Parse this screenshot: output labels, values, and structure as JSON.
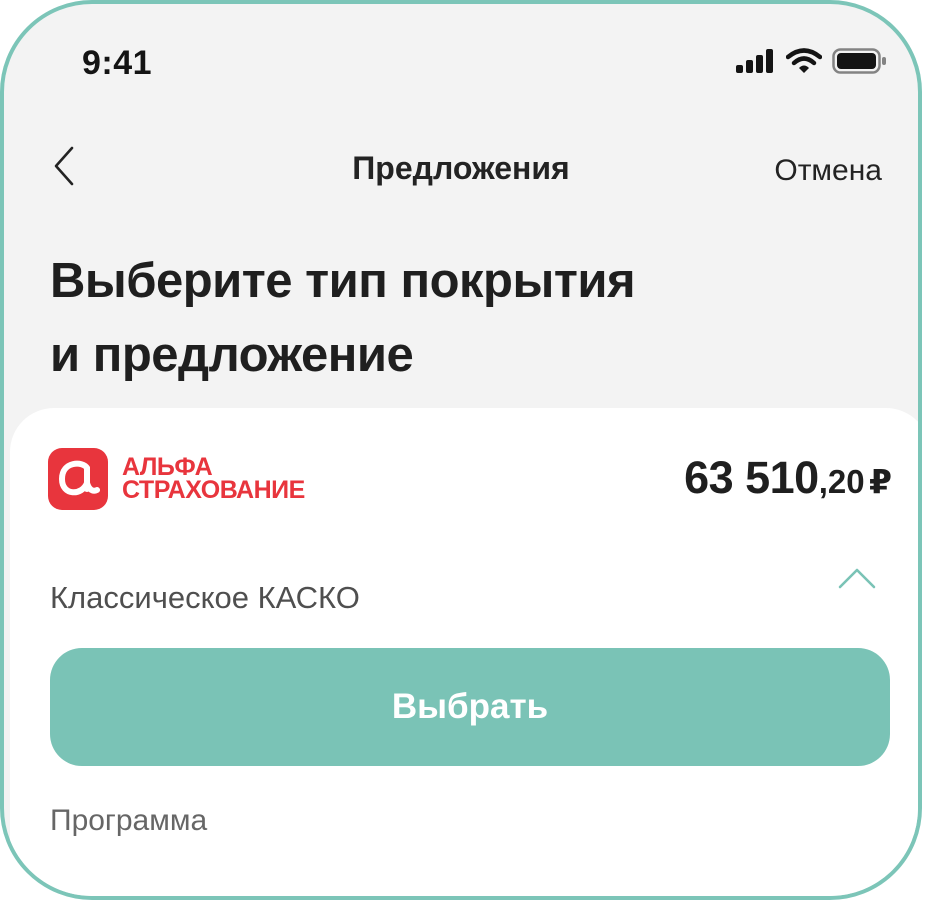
{
  "status_bar": {
    "time": "9:41",
    "icons": [
      "signal-icon",
      "wifi-icon",
      "battery-icon"
    ]
  },
  "nav": {
    "back_icon": "chevron-left-icon",
    "title": "Предложения",
    "cancel_label": "Отмена"
  },
  "heading": {
    "line1": "Выберите тип покрытия",
    "line2": "и предложение"
  },
  "offer": {
    "brand": {
      "logo_icon": "alfa-logo-icon",
      "name_line1": "АЛЬФА",
      "name_line2": "СТРАХОВАНИЕ"
    },
    "price": {
      "integer": "63 510",
      "fraction": ",20",
      "currency": "₽"
    },
    "coverage_type": "Классическое КАСКО",
    "collapse_icon": "chevron-up-icon",
    "select_label": "Выбрать",
    "program_label": "Программа"
  },
  "colors": {
    "device_frame": "#7cc5b8",
    "accent_button": "#7ac3b6",
    "brand_red": "#e8353d",
    "screen_background": "#f3f3f3",
    "card_background": "#ffffff"
  }
}
